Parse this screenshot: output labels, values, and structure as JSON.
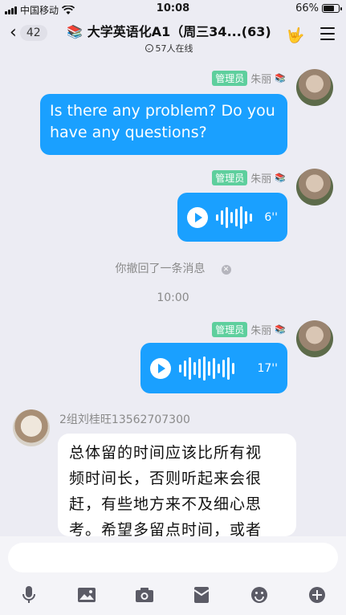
{
  "status": {
    "carrier": "中国移动",
    "time": "10:08",
    "battery": "66%"
  },
  "nav": {
    "back_count": "42",
    "group_icon": "📚",
    "title": "大学英语化A1（周三34...(63)",
    "online": "57人在线"
  },
  "messages": [
    {
      "role": "管理员",
      "name": "朱丽",
      "text": "Is there any problem? Do you have  any questions?"
    },
    {
      "role": "管理员",
      "name": "朱丽",
      "duration": "6''"
    },
    {
      "role": "管理员",
      "name": "朱丽",
      "duration": "17''"
    }
  ],
  "system": {
    "recalled": "你撤回了一条消息",
    "timestamp": "10:00"
  },
  "other": {
    "name": "2组刘桂旺13562707300",
    "lines": [
      "总体留的时间应该比所有视",
      "频时间长，否则听起来会很",
      "赶，有些地方来不及细心思",
      "考。希望多留点时间，或者"
    ]
  },
  "toolbar": {
    "icons": [
      "microphone-icon",
      "image-icon",
      "camera-icon",
      "red-packet-icon",
      "emoji-icon",
      "plus-icon"
    ]
  },
  "colors": {
    "accent": "#1aa0ff",
    "admin_badge": "#5ecf9d",
    "background": "#ececf3"
  }
}
